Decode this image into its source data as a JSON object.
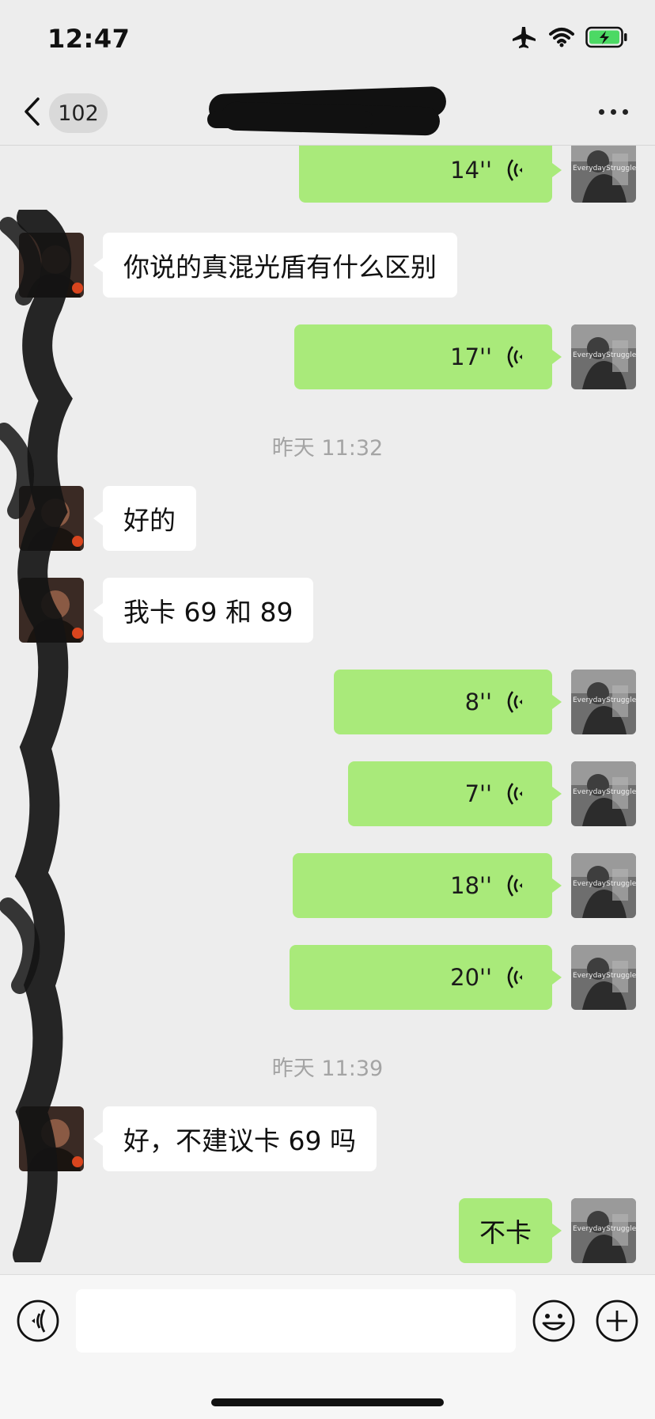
{
  "status_bar": {
    "time": "12:47",
    "icons": [
      "airplane-icon",
      "wifi-icon",
      "battery-charging-icon"
    ],
    "battery_color": "#4cd964"
  },
  "nav": {
    "back_icon": "chevron-left-icon",
    "unread_count": "102",
    "more_icon": "more-dots-icon"
  },
  "messages": [
    {
      "side": "self",
      "type": "voice",
      "duration": "14''"
    },
    {
      "side": "other",
      "type": "text",
      "text": "你说的真混光盾有什么区别"
    },
    {
      "side": "self",
      "type": "voice",
      "duration": "17''"
    },
    {
      "type": "timestamp",
      "text": "昨天 11:32"
    },
    {
      "side": "other",
      "type": "text",
      "text": "好的"
    },
    {
      "side": "other",
      "type": "text",
      "text": "我卡 69 和 89"
    },
    {
      "side": "self",
      "type": "voice",
      "duration": "8''"
    },
    {
      "side": "self",
      "type": "voice",
      "duration": "7''"
    },
    {
      "side": "self",
      "type": "voice",
      "duration": "18''"
    },
    {
      "side": "self",
      "type": "voice",
      "duration": "20''"
    },
    {
      "type": "timestamp",
      "text": "昨天 11:39"
    },
    {
      "side": "other",
      "type": "text",
      "text": "好，不建议卡 69 吗"
    },
    {
      "side": "self",
      "type": "text",
      "text": "不卡"
    }
  ],
  "self_avatar_caption": "EverydayStruggle",
  "colors": {
    "self_bubble": "#a9ea7a",
    "other_bubble": "#ffffff",
    "background": "#ededed"
  },
  "input_bar": {
    "voice_icon": "voice-mode-icon",
    "input_value": "",
    "emoji_icon": "emoji-icon",
    "plus_icon": "plus-icon"
  }
}
